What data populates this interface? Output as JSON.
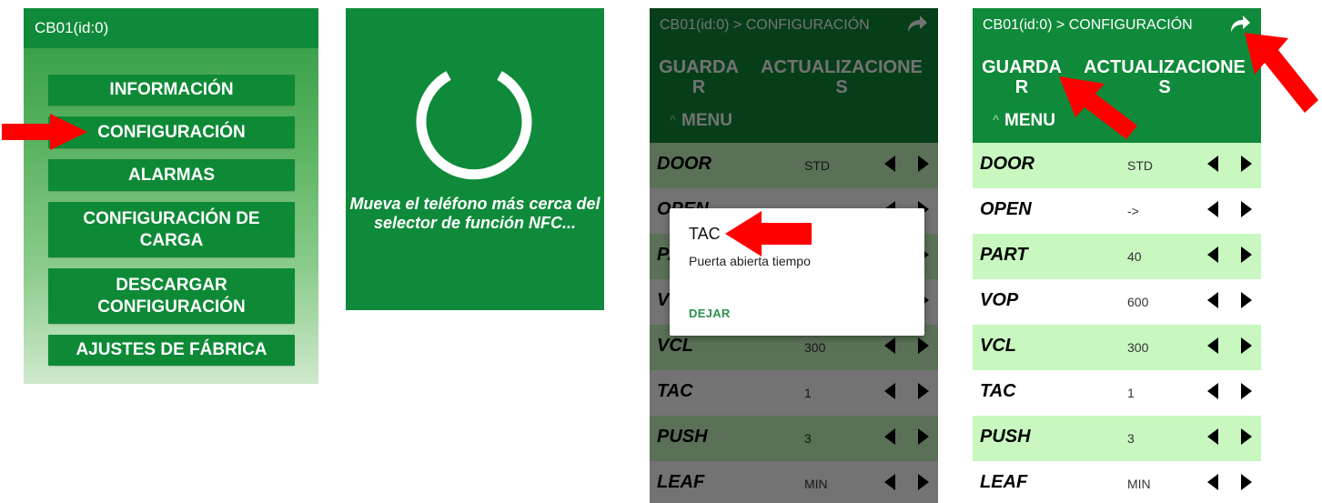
{
  "colors": {
    "accent_green": "#0f8a3a",
    "row_highlight": "#c8f8c0",
    "arrow_red": "#ff0000",
    "dialog_button": "#2e8f4a"
  },
  "screen_menu": {
    "title": "CB01(id:0)",
    "buttons": [
      {
        "label": "INFORMACIÓN"
      },
      {
        "label": "CONFIGURACIÓN"
      },
      {
        "label": "ALARMAS"
      },
      {
        "label": "CONFIGURACIÓN DE CARGA"
      },
      {
        "label": "DESCARGAR CONFIGURACIÓN"
      },
      {
        "label": "AJUSTES DE FÁBRICA"
      }
    ]
  },
  "screen_nfc": {
    "message": "Mueva el teléfono más cerca del selector de función NFC..."
  },
  "screen_config": {
    "path": "CB01(id:0) > CONFIGURACIÓN",
    "share_icon": "share-arrow-icon",
    "tabs": [
      {
        "line1": "GUARDA",
        "line2": "R"
      },
      {
        "line1": "ACTUALIZACIONE",
        "line2": "S"
      }
    ],
    "menu_label": "MENU",
    "rows": [
      {
        "name": "DOOR",
        "value": "STD"
      },
      {
        "name": "OPEN",
        "value": "->"
      },
      {
        "name": "PART",
        "value": "40"
      },
      {
        "name": "VOP",
        "value": "600"
      },
      {
        "name": "VCL",
        "value": "300"
      },
      {
        "name": "TAC",
        "value": "1"
      },
      {
        "name": "PUSH",
        "value": "3"
      },
      {
        "name": "LEAF",
        "value": "MIN"
      }
    ],
    "dialog": {
      "title": "TAC",
      "description": "Puerta abierta tiempo",
      "button": "DEJAR"
    }
  }
}
